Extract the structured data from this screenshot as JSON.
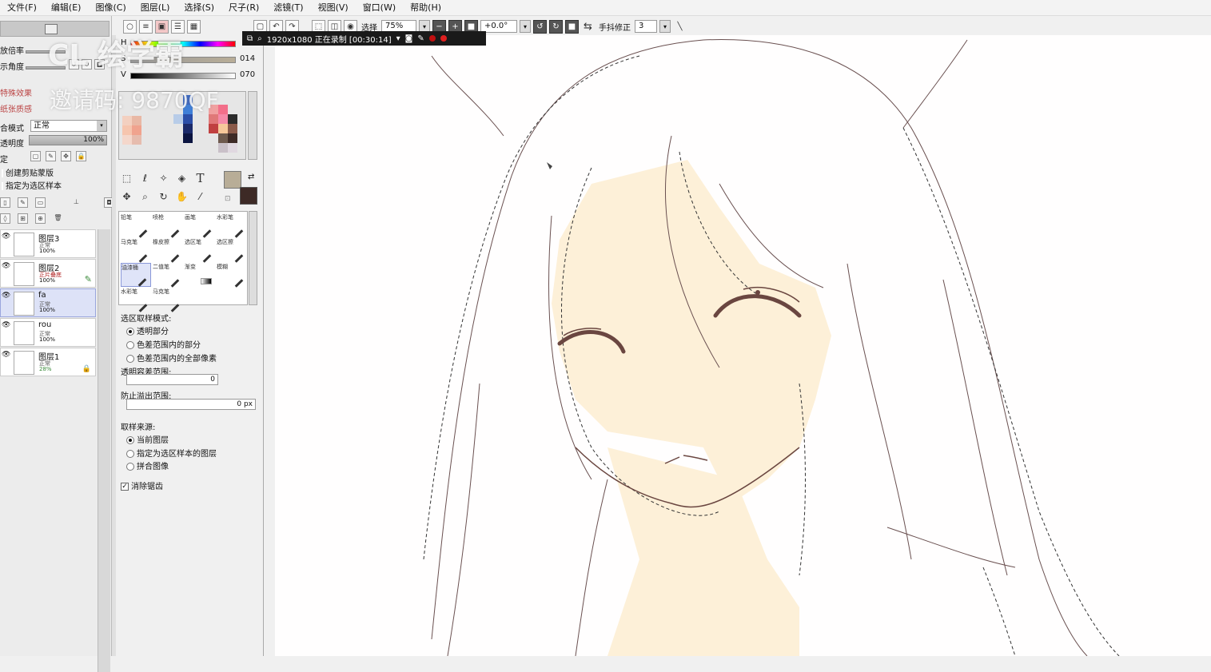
{
  "menu": [
    "文件(F)",
    "编辑(E)",
    "图像(C)",
    "图层(L)",
    "选择(S)",
    "尺子(R)",
    "滤镜(T)",
    "视图(V)",
    "窗口(W)",
    "帮助(H)"
  ],
  "toolbar": {
    "select_label": "选择",
    "zoom": "75%",
    "angle": "+0.0°",
    "stabilizer_label": "手抖修正",
    "stabilizer_value": "3"
  },
  "recording": {
    "text": "1920x1080  正在录制 [00:30:14]"
  },
  "watermark": {
    "line1": "CL 绘学霸",
    "line2": "邀请码: 9870QF"
  },
  "left_panel": {
    "zoom_label": "放倍率",
    "angle_label": "示角度",
    "special_effects": "特殊效果",
    "paper_texture": "纸张质感",
    "blend_label": "合模式",
    "blend_value": "正常",
    "opacity_label": "透明度",
    "opacity_value": "100%",
    "lock_label": "定",
    "clip_mask": "创建剪贴蒙版",
    "sample_source": "指定为选区样本"
  },
  "layers": [
    {
      "name": "图层3",
      "mode": "正常",
      "opacity": "100%"
    },
    {
      "name": "图层2",
      "mode": "正片叠底",
      "opacity": "100%"
    },
    {
      "name": "fa",
      "mode": "正常",
      "opacity": "100%"
    },
    {
      "name": "rou",
      "mode": "正常",
      "opacity": "100%"
    },
    {
      "name": "图层1",
      "mode": "正常",
      "opacity": "28%"
    }
  ],
  "color": {
    "h_label": "H",
    "s_label": "S",
    "v_label": "V",
    "s_value": "014",
    "v_value": "070",
    "fg": "#b8ad97",
    "bg": "#3d2a26"
  },
  "brushes": [
    {
      "name": "铅笔"
    },
    {
      "name": "喷枪"
    },
    {
      "name": "画笔"
    },
    {
      "name": "水彩笔"
    },
    {
      "name": "马克笔"
    },
    {
      "name": "橡皮擦"
    },
    {
      "name": "选区笔"
    },
    {
      "name": "选区擦"
    },
    {
      "name": "油漆桶"
    },
    {
      "name": "二值笔"
    },
    {
      "name": "渐变"
    },
    {
      "name": "模糊"
    },
    {
      "name": "水彩笔"
    },
    {
      "name": "马克笔"
    }
  ],
  "options": {
    "mode_title": "选区取样模式:",
    "mode_opts": [
      "透明部分",
      "色差范围内的部分",
      "色差范围内的全部像素"
    ],
    "tolerance_label": "透明容差范围:",
    "tolerance_value": "0",
    "overflow_label": "防止溢出范围:",
    "overflow_value": "0 px",
    "source_title": "取样来源:",
    "source_opts": [
      "当前图层",
      "指定为选区样本的图层",
      "拼合图像"
    ],
    "antialias_label": "消除锯齿"
  }
}
